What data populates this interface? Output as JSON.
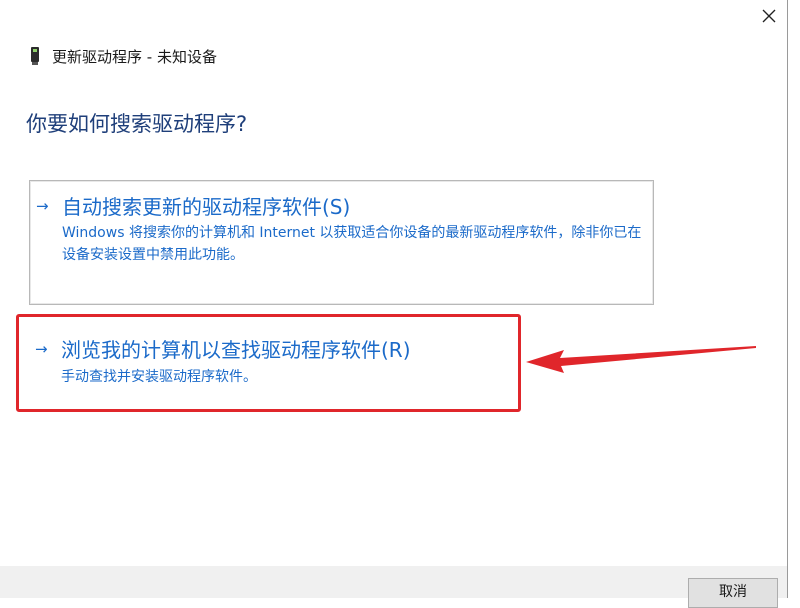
{
  "window": {
    "title": "更新驱动程序 - 未知设备",
    "close_icon": "close-icon",
    "device_icon": "device-icon"
  },
  "heading": "你要如何搜索驱动程序?",
  "options": [
    {
      "arrow": "→",
      "title": "自动搜索更新的驱动程序软件(S)",
      "description": "Windows 将搜索你的计算机和 Internet 以获取适合你设备的最新驱动程序软件，除非你已在设备安装设置中禁用此功能。"
    },
    {
      "arrow": "→",
      "title": "浏览我的计算机以查找驱动程序软件(R)",
      "description": "手动查找并安装驱动程序软件。"
    }
  ],
  "footer": {
    "cancel_label": "取消"
  },
  "colors": {
    "link": "#1b6ac9",
    "heading": "#1f3f7a",
    "annotation": "#e0262b",
    "footer_bg": "#f0f0f0"
  }
}
